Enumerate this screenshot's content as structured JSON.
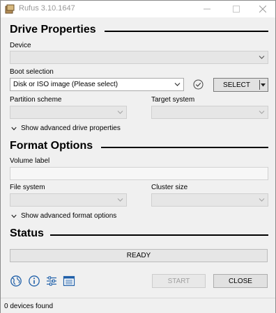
{
  "window": {
    "title": "Rufus 3.10.1647",
    "minimize_icon": "minimize-icon",
    "maximize_icon": "maximize-icon",
    "close_icon": "close-icon"
  },
  "drive_properties": {
    "heading": "Drive Properties",
    "device_label": "Device",
    "device_value": "",
    "boot_selection_label": "Boot selection",
    "boot_selection_value": "Disk or ISO image (Please select)",
    "select_button": "SELECT",
    "partition_scheme_label": "Partition scheme",
    "partition_scheme_value": "",
    "target_system_label": "Target system",
    "target_system_value": "",
    "advanced_toggle": "Show advanced drive properties"
  },
  "format_options": {
    "heading": "Format Options",
    "volume_label_label": "Volume label",
    "volume_label_value": "",
    "file_system_label": "File system",
    "file_system_value": "",
    "cluster_size_label": "Cluster size",
    "cluster_size_value": "",
    "advanced_toggle": "Show advanced format options"
  },
  "status": {
    "heading": "Status",
    "state": "READY"
  },
  "toolbar": {
    "icons": [
      "globe-icon",
      "info-icon",
      "settings-icon",
      "log-icon"
    ],
    "start_button": "START",
    "close_button": "CLOSE"
  },
  "footer": {
    "status_text": "0 devices found"
  },
  "colors": {
    "accent_icon": "#1f5fa8",
    "background": "#f0f0f0",
    "disabled_text": "#a0a0a0"
  }
}
